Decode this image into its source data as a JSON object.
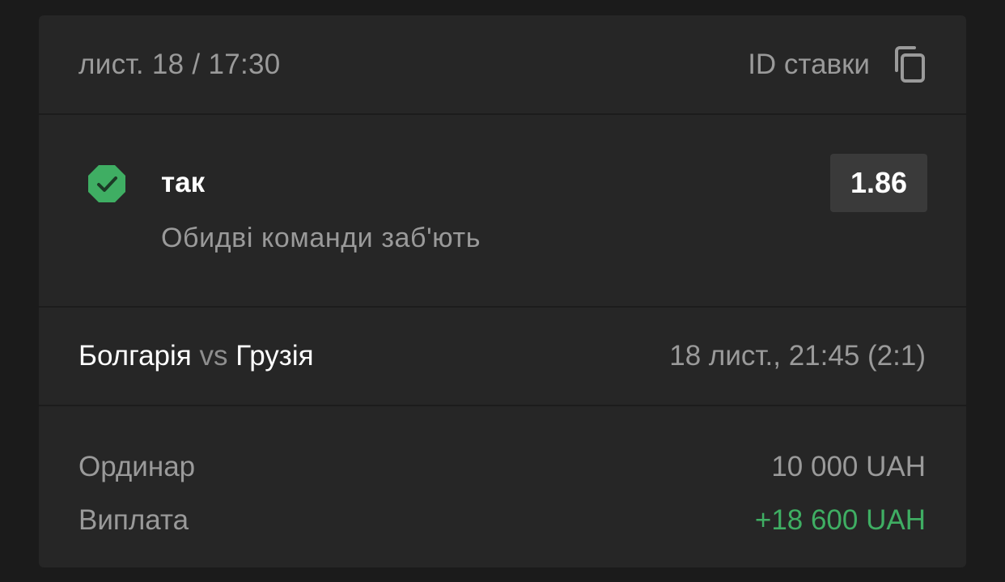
{
  "header": {
    "datetime": "лист. 18 / 17:30",
    "bet_id_label": "ID ставки",
    "copy_icon": "copy-icon"
  },
  "selection": {
    "status_icon": "check-badge-icon",
    "status_color": "#3fae63",
    "pick": "так",
    "market": "Обидві команди заб'ють",
    "odds": "1.86"
  },
  "event": {
    "home": "Болгарія",
    "vs": "vs",
    "away": "Грузія",
    "time_score": "18 лист., 21:45 (2:1)"
  },
  "summary": {
    "type_label": "Ординар",
    "stake": "10 000 UAH",
    "payout_label": "Виплата",
    "payout": "+18 600 UAH",
    "payout_color": "#3fae63"
  }
}
